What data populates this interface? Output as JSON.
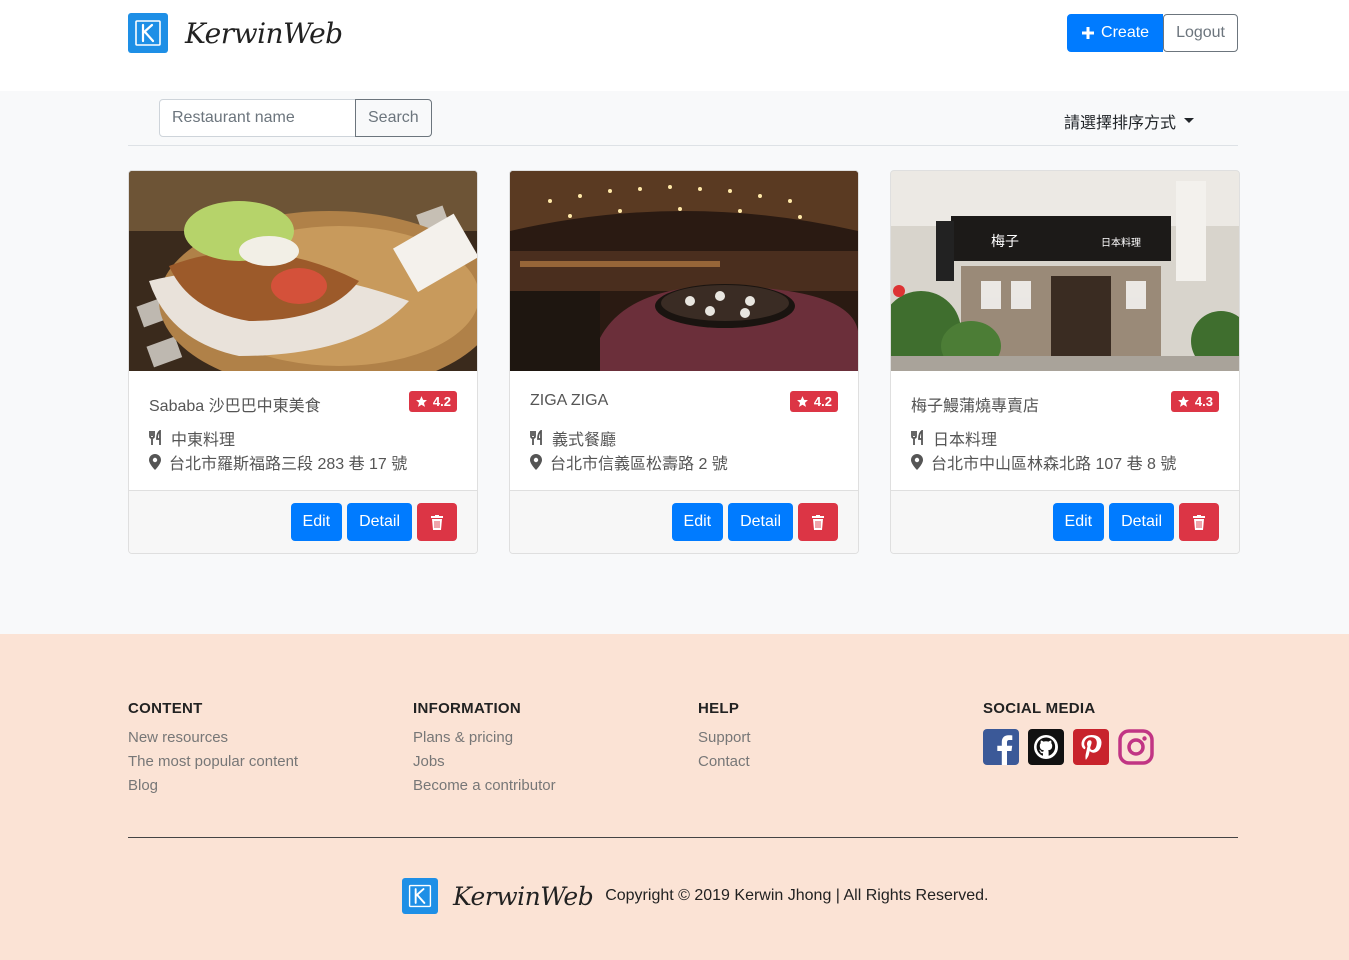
{
  "header": {
    "brand": "KerwinWeb",
    "create_label": "Create",
    "logout_label": "Logout"
  },
  "toolbar": {
    "search_placeholder": "Restaurant name",
    "search_label": "Search",
    "sort_label": "請選擇排序方式"
  },
  "restaurants": [
    {
      "name": "Sababa 沙巴巴中東美食",
      "rating": "4.2",
      "category": "中東料理",
      "address": "台北市羅斯福路三段 283 巷 17 號"
    },
    {
      "name": "ZIGA ZIGA",
      "rating": "4.2",
      "category": "義式餐廳",
      "address": "台北市信義區松壽路 2 號"
    },
    {
      "name": "梅子鰻蒲燒專賣店",
      "rating": "4.3",
      "category": "日本料理",
      "address": "台北市中山區林森北路 107 巷 8 號"
    }
  ],
  "card_actions": {
    "edit_label": "Edit",
    "detail_label": "Detail"
  },
  "footer": {
    "columns": [
      {
        "title": "CONTENT",
        "links": [
          "New resources",
          "The most popular content",
          "Blog"
        ]
      },
      {
        "title": "INFORMATION",
        "links": [
          "Plans & pricing",
          "Jobs",
          "Become a contributor"
        ]
      },
      {
        "title": "HELP",
        "links": [
          "Support",
          "Contact"
        ]
      },
      {
        "title": "SOCIAL MEDIA",
        "links": []
      }
    ],
    "social_icons": [
      "facebook-icon",
      "github-icon",
      "pinterest-icon",
      "instagram-icon"
    ],
    "brand": "KerwinWeb",
    "copyright": "Copyright © 2019 Kerwin Jhong | All Rights Reserved."
  },
  "colors": {
    "primary": "#007bff",
    "danger": "#dc3545",
    "footer_bg": "#fbe3d5",
    "logo_blue": "#1e8fe6"
  }
}
